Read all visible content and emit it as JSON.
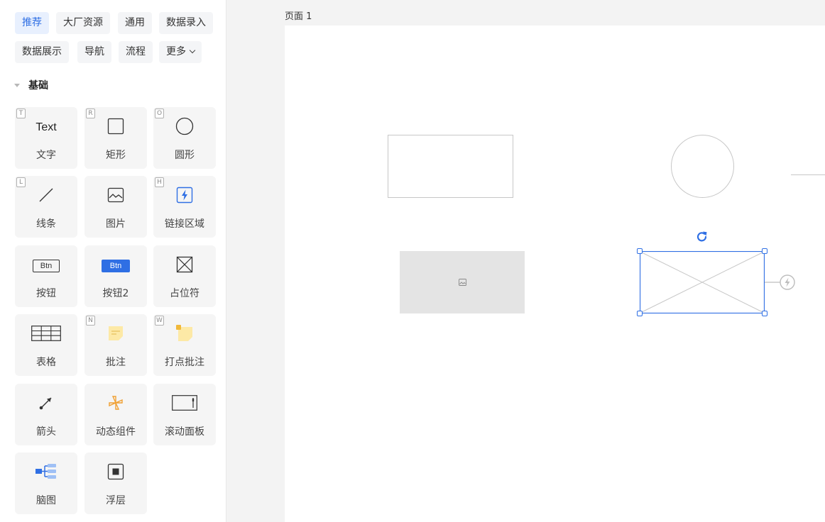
{
  "sidebar": {
    "tabs": [
      {
        "label": "推荐",
        "active": true
      },
      {
        "label": "大厂资源",
        "active": false
      },
      {
        "label": "通用",
        "active": false
      },
      {
        "label": "数据录入",
        "active": false
      },
      {
        "label": "数据展示",
        "active": false
      },
      {
        "label": "导航",
        "active": false
      },
      {
        "label": "流程",
        "active": false
      },
      {
        "label": "更多",
        "active": false
      }
    ],
    "section_title": "基础",
    "components": [
      {
        "label": "文字",
        "shortcut": "T",
        "icon": "text-icon",
        "icon_text": "Text"
      },
      {
        "label": "矩形",
        "shortcut": "R",
        "icon": "rectangle-icon"
      },
      {
        "label": "圆形",
        "shortcut": "O",
        "icon": "circle-icon"
      },
      {
        "label": "线条",
        "shortcut": "L",
        "icon": "line-icon"
      },
      {
        "label": "图片",
        "shortcut": "",
        "icon": "image-icon"
      },
      {
        "label": "链接区域",
        "shortcut": "H",
        "icon": "link-area-icon"
      },
      {
        "label": "按钮",
        "shortcut": "",
        "icon": "button-outline-icon",
        "icon_text": "Btn"
      },
      {
        "label": "按钮2",
        "shortcut": "",
        "icon": "button-filled-icon",
        "icon_text": "Btn"
      },
      {
        "label": "占位符",
        "shortcut": "",
        "icon": "placeholder-icon"
      },
      {
        "label": "表格",
        "shortcut": "",
        "icon": "table-icon"
      },
      {
        "label": "批注",
        "shortcut": "N",
        "icon": "note-icon"
      },
      {
        "label": "打点批注",
        "shortcut": "W",
        "icon": "pin-note-icon"
      },
      {
        "label": "箭头",
        "shortcut": "",
        "icon": "arrow-icon"
      },
      {
        "label": "动态组件",
        "shortcut": "",
        "icon": "dynamic-component-icon"
      },
      {
        "label": "滚动面板",
        "shortcut": "",
        "icon": "scroll-panel-icon"
      },
      {
        "label": "脑图",
        "shortcut": "",
        "icon": "mind-map-icon"
      },
      {
        "label": "浮层",
        "shortcut": "",
        "icon": "overlay-icon"
      }
    ]
  },
  "canvas": {
    "page_label": "页面 1",
    "selection_color": "#2f6fe4",
    "shapes": [
      "rectangle",
      "circle",
      "line",
      "image",
      "placeholder"
    ]
  },
  "colors": {
    "accent": "#2f6fe4",
    "note": "#fde9a6",
    "dynamic": "#f0a033"
  }
}
